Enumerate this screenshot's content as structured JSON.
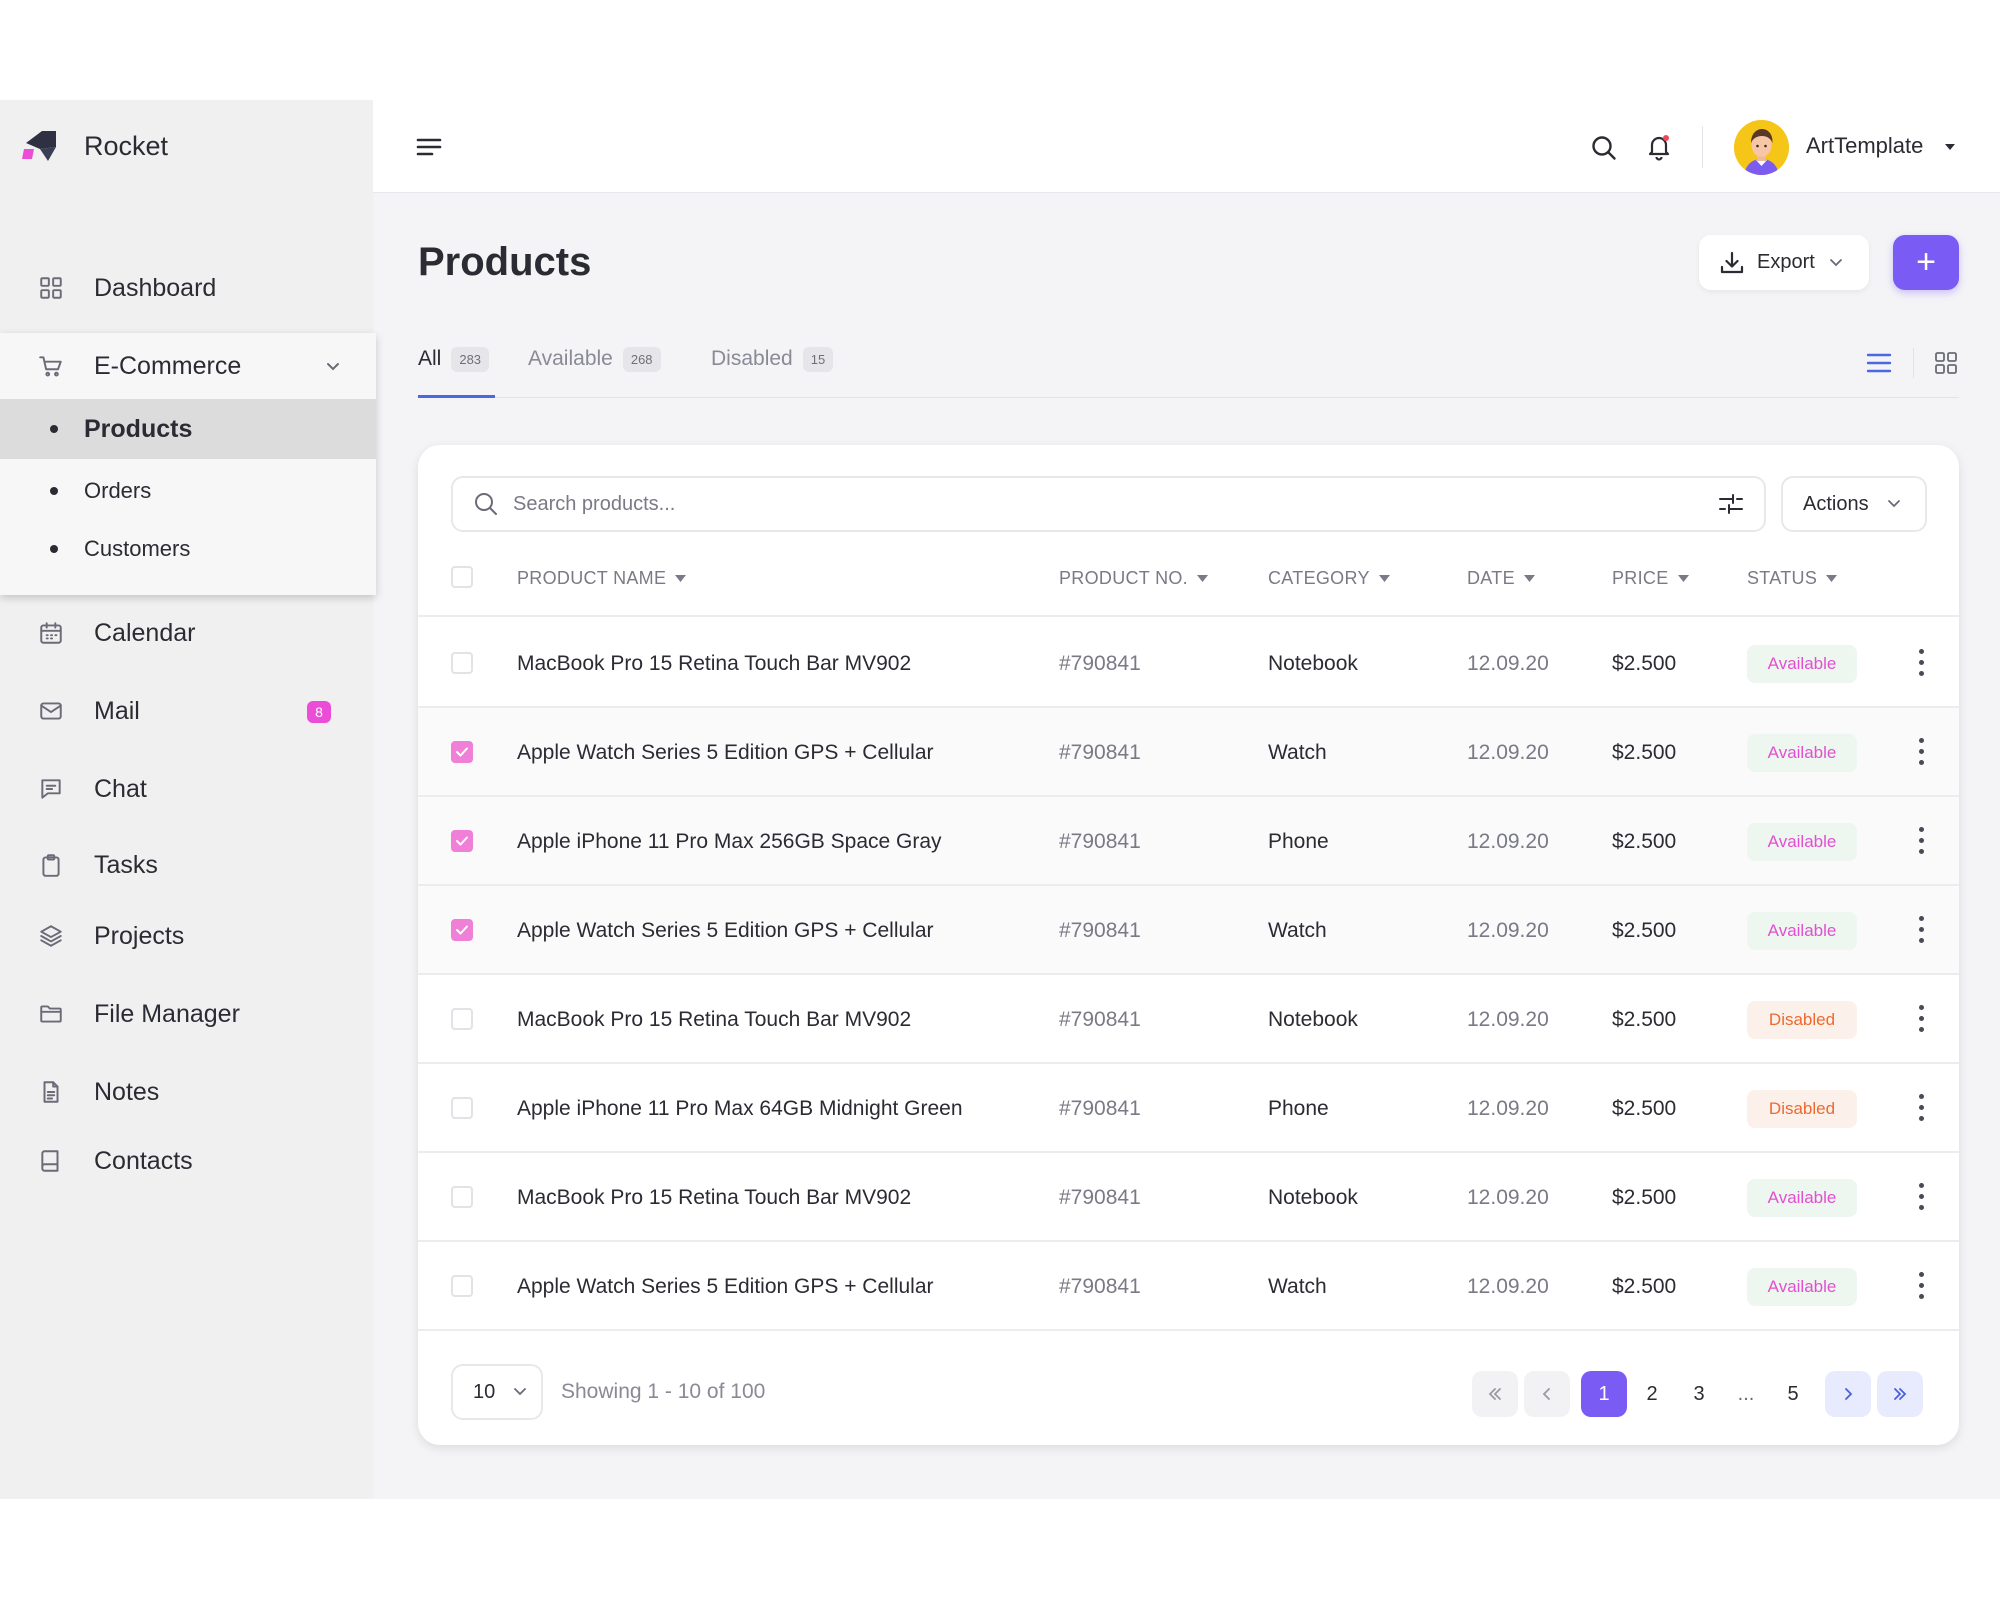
{
  "app": {
    "name": "Rocket"
  },
  "sidebar": {
    "dashboard": "Dashboard",
    "ecommerce": {
      "label": "E-Commerce",
      "items": [
        "Products",
        "Orders",
        "Customers"
      ]
    },
    "calendar": "Calendar",
    "mail": "Mail",
    "mail_badge": "8",
    "chat": "Chat",
    "tasks": "Tasks",
    "projects": "Projects",
    "file_manager": "File Manager",
    "notes": "Notes",
    "contacts": "Contacts"
  },
  "topbar": {
    "user_name": "ArtTemplate"
  },
  "page": {
    "title": "Products",
    "export_label": "Export",
    "add_label": "+"
  },
  "tabs": [
    {
      "label": "All",
      "count": "283"
    },
    {
      "label": "Available",
      "count": "268"
    },
    {
      "label": "Disabled",
      "count": "15"
    }
  ],
  "search": {
    "placeholder": "Search products...",
    "actions_label": "Actions"
  },
  "table": {
    "headers": [
      "PRODUCT NAME",
      "PRODUCT NO.",
      "CATEGORY",
      "DATE",
      "PRICE",
      "STATUS"
    ],
    "rows": [
      {
        "checked": false,
        "name": "MacBook Pro 15 Retina Touch Bar MV902",
        "no": "#790841",
        "category": "Notebook",
        "date": "12.09.20",
        "price": "$2.500",
        "status": "Available"
      },
      {
        "checked": true,
        "name": "Apple Watch Series 5 Edition GPS + Cellular",
        "no": "#790841",
        "category": "Watch",
        "date": "12.09.20",
        "price": "$2.500",
        "status": "Available"
      },
      {
        "checked": true,
        "name": "Apple iPhone 11 Pro Max 256GB Space Gray",
        "no": "#790841",
        "category": "Phone",
        "date": "12.09.20",
        "price": "$2.500",
        "status": "Available"
      },
      {
        "checked": true,
        "name": "Apple Watch Series 5 Edition GPS + Cellular",
        "no": "#790841",
        "category": "Watch",
        "date": "12.09.20",
        "price": "$2.500",
        "status": "Available"
      },
      {
        "checked": false,
        "name": "MacBook Pro 15 Retina Touch Bar MV902",
        "no": "#790841",
        "category": "Notebook",
        "date": "12.09.20",
        "price": "$2.500",
        "status": "Disabled"
      },
      {
        "checked": false,
        "name": "Apple iPhone 11 Pro Max 64GB Midnight Green",
        "no": "#790841",
        "category": "Phone",
        "date": "12.09.20",
        "price": "$2.500",
        "status": "Disabled"
      },
      {
        "checked": false,
        "name": "MacBook Pro 15 Retina Touch Bar MV902",
        "no": "#790841",
        "category": "Notebook",
        "date": "12.09.20",
        "price": "$2.500",
        "status": "Available"
      },
      {
        "checked": false,
        "name": "Apple Watch Series 5 Edition GPS + Cellular",
        "no": "#790841",
        "category": "Watch",
        "date": "12.09.20",
        "price": "$2.500",
        "status": "Available"
      }
    ]
  },
  "footer": {
    "per_page": "10",
    "showing": "Showing 1 - 10 of 100",
    "pages": [
      "1",
      "2",
      "3",
      "...",
      "5"
    ],
    "current_page": "1"
  },
  "colors": {
    "accent": "#7a5cf5",
    "tab_indicator": "#4a68e0",
    "badge": "#ec4dd7",
    "available_text": "#e24fd2",
    "disabled_text": "#ec6a2f"
  },
  "icons": [
    "rocket-logo",
    "menu-icon",
    "search-icon",
    "bell-icon",
    "download-icon",
    "filter-icon",
    "list-view-icon",
    "grid-view-icon",
    "kebab-icon"
  ]
}
